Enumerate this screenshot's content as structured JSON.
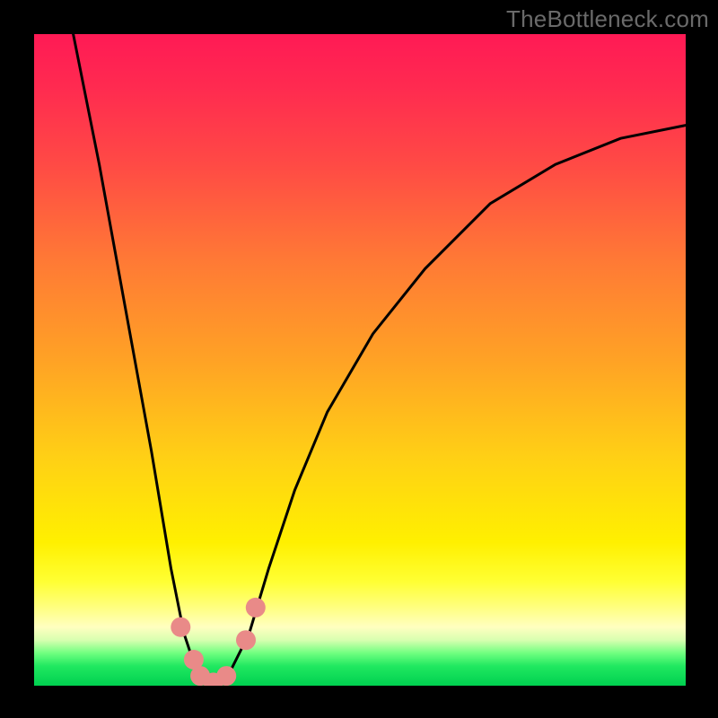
{
  "watermark": "TheBottleneck.com",
  "chart_data": {
    "type": "line",
    "title": "",
    "xlabel": "",
    "ylabel": "",
    "xlim": [
      0,
      100
    ],
    "ylim": [
      0,
      100
    ],
    "grid": false,
    "legend": false,
    "series": [
      {
        "name": "bottleneck-curve",
        "x": [
          6,
          10,
          14,
          18,
          21,
          23,
          25,
          27,
          28,
          30,
          33,
          36,
          40,
          45,
          52,
          60,
          70,
          80,
          90,
          100
        ],
        "y": [
          100,
          80,
          58,
          36,
          18,
          8,
          2,
          0,
          0,
          2,
          8,
          18,
          30,
          42,
          54,
          64,
          74,
          80,
          84,
          86
        ]
      }
    ],
    "markers": {
      "name": "highlight-points",
      "color_hex": "#e98a88",
      "points": [
        {
          "x": 22.5,
          "y": 9
        },
        {
          "x": 24.5,
          "y": 4
        },
        {
          "x": 25.5,
          "y": 1.5
        },
        {
          "x": 27.5,
          "y": 0.5
        },
        {
          "x": 29.5,
          "y": 1.5
        },
        {
          "x": 32.5,
          "y": 7
        },
        {
          "x": 34.0,
          "y": 12
        }
      ]
    },
    "background": {
      "type": "vertical-gradient",
      "stops": [
        {
          "pos": 0.0,
          "color": "#ff1a55"
        },
        {
          "pos": 0.5,
          "color": "#ffa225"
        },
        {
          "pos": 0.8,
          "color": "#fff000"
        },
        {
          "pos": 0.92,
          "color": "#ffffc0"
        },
        {
          "pos": 1.0,
          "color": "#00d050"
        }
      ]
    }
  }
}
